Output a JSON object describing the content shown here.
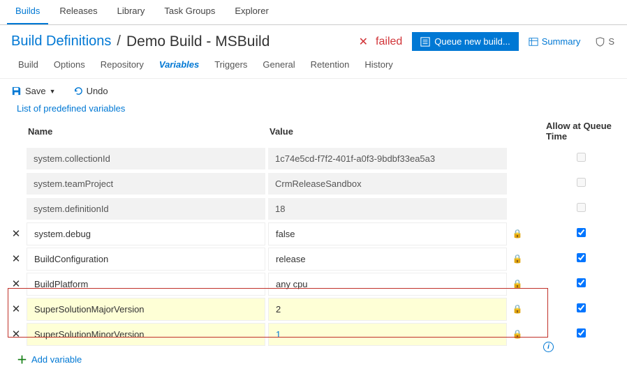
{
  "topnav": {
    "tabs": [
      "Builds",
      "Releases",
      "Library",
      "Task Groups",
      "Explorer"
    ],
    "active": 0
  },
  "header": {
    "breadcrumb_link": "Build Definitions",
    "title": "Demo Build - MSBuild",
    "status_text": "failed",
    "queue_btn": "Queue new build...",
    "summary_btn": "Summary",
    "security_btn": "S"
  },
  "subnav": {
    "items": [
      "Build",
      "Options",
      "Repository",
      "Variables",
      "Triggers",
      "General",
      "Retention",
      "History"
    ],
    "active": 3
  },
  "toolbar": {
    "save_label": "Save",
    "undo_label": "Undo"
  },
  "table": {
    "predef_link": "List of predefined variables",
    "col_name": "Name",
    "col_value": "Value",
    "col_allow": "Allow at Queue Time",
    "rows": [
      {
        "name": "system.collectionId",
        "value": "1c74e5cd-f7f2-401f-a0f3-9bdbf33ea5a3",
        "type": "readonly",
        "del": false,
        "lock": false,
        "check": false,
        "check_on": false
      },
      {
        "name": "system.teamProject",
        "value": "CrmReleaseSandbox",
        "type": "readonly",
        "del": false,
        "lock": false,
        "check": false,
        "check_on": false
      },
      {
        "name": "system.definitionId",
        "value": "18",
        "type": "readonly",
        "del": false,
        "lock": false,
        "check": false,
        "check_on": false
      },
      {
        "name": "system.debug",
        "value": "false",
        "type": "editable",
        "del": true,
        "lock": true,
        "check": true,
        "check_on": true
      },
      {
        "name": "BuildConfiguration",
        "value": "release",
        "type": "editable",
        "del": true,
        "lock": true,
        "check": true,
        "check_on": true
      },
      {
        "name": "BuildPlatform",
        "value": "any cpu",
        "type": "editable",
        "del": true,
        "lock": true,
        "check": true,
        "check_on": true
      },
      {
        "name": "SuperSolutionMajorVersion",
        "value": "2",
        "type": "hl",
        "del": true,
        "lock": true,
        "check": true,
        "check_on": true
      },
      {
        "name": "SuperSolutionMinorVersion",
        "value": "1",
        "type": "hl last",
        "del": true,
        "lock": true,
        "check": true,
        "check_on": true
      }
    ],
    "add_variable": "Add variable"
  }
}
